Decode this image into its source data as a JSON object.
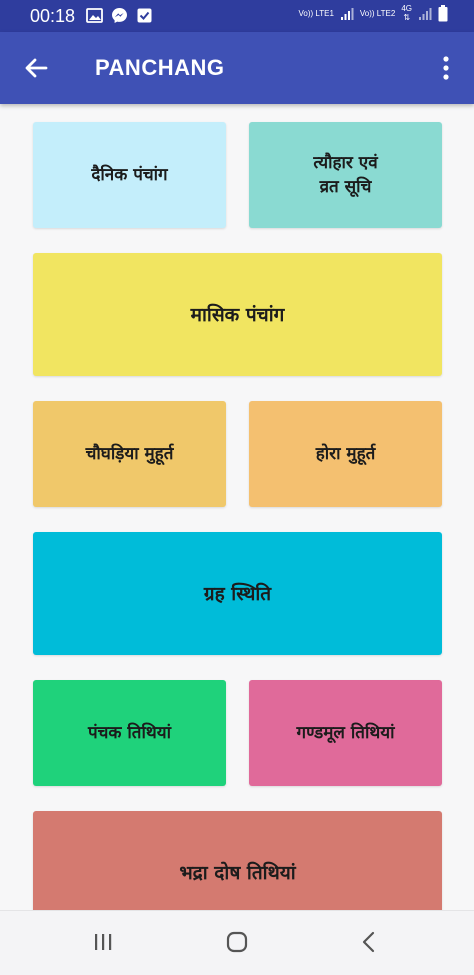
{
  "status_bar": {
    "time": "00:18",
    "sim1_label": "Vo)) LTE1",
    "sim2_label": "Vo)) LTE2",
    "network_type": "4G",
    "icons": [
      "gallery-icon",
      "messenger-icon",
      "download-check-icon",
      "signal-icon",
      "battery-icon"
    ]
  },
  "app_bar": {
    "title": "PANCHANG",
    "back_icon": "arrow-left-icon",
    "menu_icon": "more-vert-icon"
  },
  "tiles": [
    {
      "label": "दैनिक पंचांग",
      "color": "#c4eefb"
    },
    {
      "label": "त्यौहार एवं\nव्रत सूचि",
      "color": "#8adad2"
    },
    {
      "label": "मासिक पंचांग",
      "color": "#f1e561"
    },
    {
      "label": "चौघड़िया मुहूर्त",
      "color": "#f0c86a"
    },
    {
      "label": "होरा मुहूर्त",
      "color": "#f4c070"
    },
    {
      "label": "ग्रह स्थिति",
      "color": "#00bcd9"
    },
    {
      "label": "पंचक तिथियां",
      "color": "#1fd27b"
    },
    {
      "label": "गण्डमूल तिथियां",
      "color": "#e06a9a"
    },
    {
      "label": "भद्रा दोष तिथियां",
      "color": "#d47a70"
    }
  ],
  "nav_bar": {
    "recents_icon": "recent-apps-icon",
    "home_icon": "home-icon",
    "back_icon": "back-chevron-icon"
  }
}
